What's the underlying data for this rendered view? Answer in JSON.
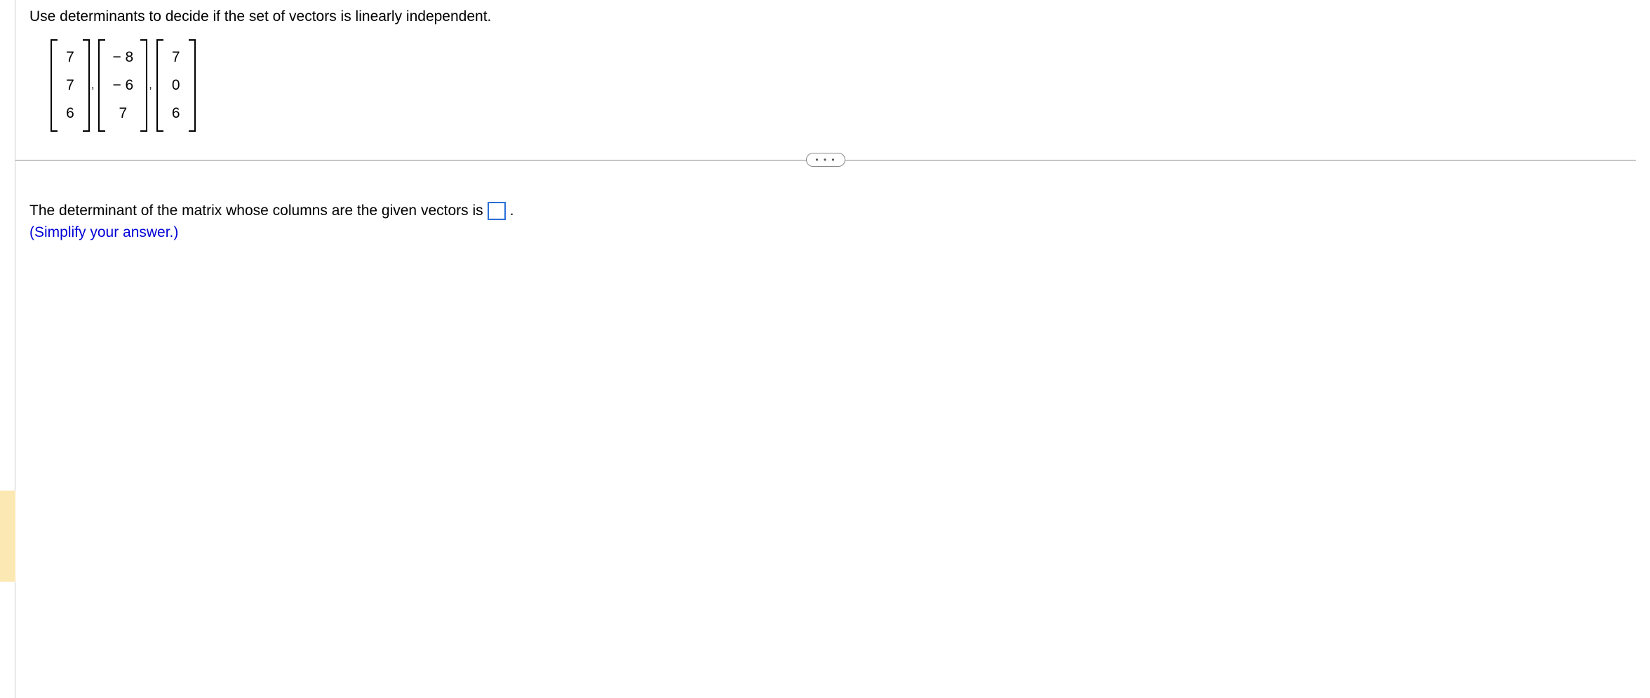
{
  "problem": {
    "instruction": "Use determinants to decide if the set of vectors is linearly independent.",
    "vectors": {
      "v1": {
        "r1": "7",
        "r2": "7",
        "r3": "6"
      },
      "v2": {
        "r1": "− 8",
        "r2": "− 6",
        "r3": "7"
      },
      "v3": {
        "r1": "7",
        "r2": "0",
        "r3": "6"
      }
    },
    "separator": ",",
    "divider_dots": "• • •"
  },
  "answer": {
    "prefix": "The determinant of the matrix whose columns are the given vectors is",
    "suffix": ".",
    "note": "(Simplify your answer.)"
  }
}
